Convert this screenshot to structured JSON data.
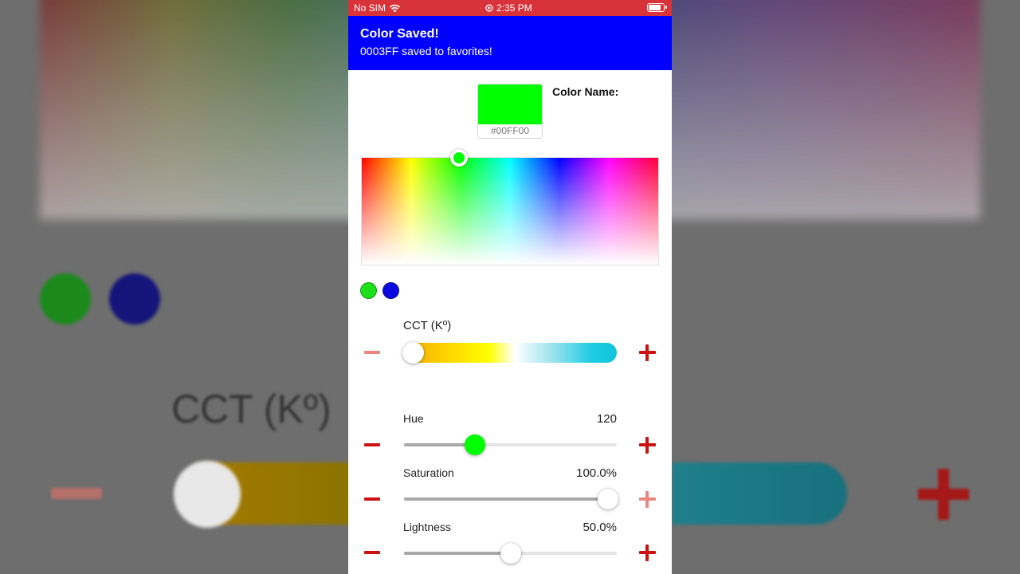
{
  "status_bar": {
    "carrier": "No SIM",
    "time": "2:35 PM"
  },
  "toast": {
    "title": "Color Saved!",
    "message": "0003FF saved to favorites!"
  },
  "swatch": {
    "color": "#00FF00",
    "hex_label": "#00FF00"
  },
  "color_name_label": "Color Name:",
  "favorites": [
    {
      "color": "#1de01d"
    },
    {
      "color": "#0a0ae0"
    }
  ],
  "sliders": {
    "cct": {
      "label": "CCT (Kº)",
      "position": 0.0
    },
    "hue": {
      "label": "Hue",
      "value": "120",
      "position": 0.333
    },
    "saturation": {
      "label": "Saturation",
      "value": "100.0%",
      "position": 1.0
    },
    "lightness": {
      "label": "Lightness",
      "value": "50.0%",
      "position": 0.5
    }
  },
  "background": {
    "label": "CCT (Kº)"
  },
  "colors": {
    "status_bar": "#d8333b",
    "toast": "#0000ff",
    "accent_red": "#cc1111",
    "disabled_red": "#e8877e",
    "hue_knob": "#00ff00"
  }
}
